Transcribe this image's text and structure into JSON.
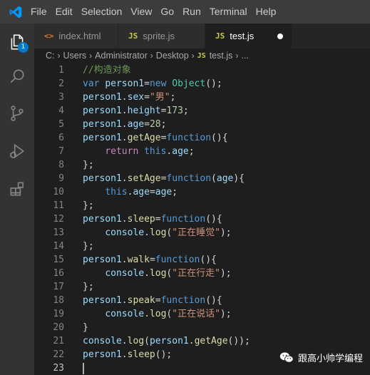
{
  "menu": [
    "File",
    "Edit",
    "Selection",
    "View",
    "Go",
    "Run",
    "Terminal",
    "Help"
  ],
  "activity_bar": {
    "items": [
      "explorer-icon",
      "search-icon",
      "source-control-icon",
      "run-debug-icon",
      "extensions-icon"
    ],
    "explorer_badge": "1"
  },
  "tabs": [
    {
      "icon": "<>",
      "label": "index.html",
      "icon_color": "#e37933"
    },
    {
      "icon": "JS",
      "label": "sprite.js",
      "icon_color": "#cbcb41"
    },
    {
      "icon": "JS",
      "label": "test.js",
      "icon_color": "#cbcb41",
      "active": true,
      "dirty": true
    }
  ],
  "breadcrumb": {
    "parts": [
      "C:",
      "Users",
      "Administrator",
      "Desktop"
    ],
    "file_icon": "JS",
    "file": "test.js",
    "tail": "..."
  },
  "editor": {
    "lines": [
      [
        [
          "c",
          "//构造对象"
        ]
      ],
      [
        [
          "k",
          "var"
        ],
        [
          "p",
          " "
        ],
        [
          "v",
          "person1"
        ],
        [
          "p",
          "="
        ],
        [
          "k",
          "new"
        ],
        [
          "p",
          " "
        ],
        [
          "c2",
          "Object"
        ],
        [
          "p",
          "();"
        ]
      ],
      [
        [
          "v",
          "person1"
        ],
        [
          "p",
          "."
        ],
        [
          "v",
          "sex"
        ],
        [
          "p",
          "="
        ],
        [
          "s",
          "\"男\""
        ],
        [
          "p",
          ";"
        ]
      ],
      [
        [
          "v",
          "person1"
        ],
        [
          "p",
          "."
        ],
        [
          "v",
          "height"
        ],
        [
          "p",
          "="
        ],
        [
          "n",
          "173"
        ],
        [
          "p",
          ";"
        ]
      ],
      [
        [
          "v",
          "person1"
        ],
        [
          "p",
          "."
        ],
        [
          "v",
          "age"
        ],
        [
          "p",
          "="
        ],
        [
          "n",
          "28"
        ],
        [
          "p",
          ";"
        ]
      ],
      [
        [
          "v",
          "person1"
        ],
        [
          "p",
          "."
        ],
        [
          "f",
          "getAge"
        ],
        [
          "p",
          "="
        ],
        [
          "k",
          "function"
        ],
        [
          "p",
          "(){"
        ]
      ],
      [
        [
          "p",
          "    "
        ],
        [
          "r",
          "return"
        ],
        [
          "p",
          " "
        ],
        [
          "k",
          "this"
        ],
        [
          "p",
          "."
        ],
        [
          "v",
          "age"
        ],
        [
          "p",
          ";"
        ]
      ],
      [
        [
          "p",
          "};"
        ]
      ],
      [
        [
          "v",
          "person1"
        ],
        [
          "p",
          "."
        ],
        [
          "f",
          "setAge"
        ],
        [
          "p",
          "="
        ],
        [
          "k",
          "function"
        ],
        [
          "p",
          "("
        ],
        [
          "v",
          "age"
        ],
        [
          "p",
          "){"
        ]
      ],
      [
        [
          "p",
          "    "
        ],
        [
          "k",
          "this"
        ],
        [
          "p",
          "."
        ],
        [
          "v",
          "age"
        ],
        [
          "p",
          "="
        ],
        [
          "v",
          "age"
        ],
        [
          "p",
          ";"
        ]
      ],
      [
        [
          "p",
          "};"
        ]
      ],
      [
        [
          "v",
          "person1"
        ],
        [
          "p",
          "."
        ],
        [
          "f",
          "sleep"
        ],
        [
          "p",
          "="
        ],
        [
          "k",
          "function"
        ],
        [
          "p",
          "(){"
        ]
      ],
      [
        [
          "p",
          "    "
        ],
        [
          "v",
          "console"
        ],
        [
          "p",
          "."
        ],
        [
          "f",
          "log"
        ],
        [
          "p",
          "("
        ],
        [
          "s",
          "\"正在睡觉\""
        ],
        [
          "p",
          ");"
        ]
      ],
      [
        [
          "p",
          "};"
        ]
      ],
      [
        [
          "v",
          "person1"
        ],
        [
          "p",
          "."
        ],
        [
          "f",
          "walk"
        ],
        [
          "p",
          "="
        ],
        [
          "k",
          "function"
        ],
        [
          "p",
          "(){"
        ]
      ],
      [
        [
          "p",
          "    "
        ],
        [
          "v",
          "console"
        ],
        [
          "p",
          "."
        ],
        [
          "f",
          "log"
        ],
        [
          "p",
          "("
        ],
        [
          "s",
          "\"正在行走\""
        ],
        [
          "p",
          ");"
        ]
      ],
      [
        [
          "p",
          "};"
        ]
      ],
      [
        [
          "v",
          "person1"
        ],
        [
          "p",
          "."
        ],
        [
          "f",
          "speak"
        ],
        [
          "p",
          "="
        ],
        [
          "k",
          "function"
        ],
        [
          "p",
          "(){"
        ]
      ],
      [
        [
          "p",
          "    "
        ],
        [
          "v",
          "console"
        ],
        [
          "p",
          "."
        ],
        [
          "f",
          "log"
        ],
        [
          "p",
          "("
        ],
        [
          "s",
          "\"正在说话\""
        ],
        [
          "p",
          ");"
        ]
      ],
      [
        [
          "p",
          "}"
        ]
      ],
      [
        [
          "v",
          "console"
        ],
        [
          "p",
          "."
        ],
        [
          "f",
          "log"
        ],
        [
          "p",
          "("
        ],
        [
          "v",
          "person1"
        ],
        [
          "p",
          "."
        ],
        [
          "f",
          "getAge"
        ],
        [
          "p",
          "());"
        ]
      ],
      [
        [
          "v",
          "person1"
        ],
        [
          "p",
          "."
        ],
        [
          "f",
          "sleep"
        ],
        [
          "p",
          "();"
        ]
      ],
      []
    ],
    "current_line": 23
  },
  "watermark": {
    "text": "跟高小帅学编程",
    "icon": "wechat-logo-icon"
  }
}
